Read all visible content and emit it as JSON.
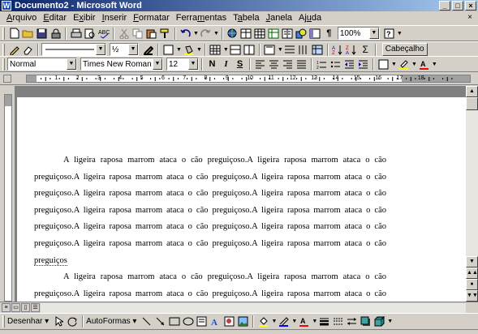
{
  "window": {
    "title": "Documento2 - Microsoft Word",
    "app_icon": "W"
  },
  "menu": [
    {
      "pre": "",
      "u": "A",
      "post": "rquivo"
    },
    {
      "pre": "",
      "u": "E",
      "post": "ditar"
    },
    {
      "pre": "E",
      "u": "x",
      "post": "ibir"
    },
    {
      "pre": "",
      "u": "I",
      "post": "nserir"
    },
    {
      "pre": "",
      "u": "F",
      "post": "ormatar"
    },
    {
      "pre": "Ferra",
      "u": "m",
      "post": "entas"
    },
    {
      "pre": "T",
      "u": "a",
      "post": "bela"
    },
    {
      "pre": "",
      "u": "J",
      "post": "anela"
    },
    {
      "pre": "Aj",
      "u": "u",
      "post": "da"
    }
  ],
  "toolbar": {
    "zoom": "100%",
    "line_width": "½",
    "style_button": "Cabeçalho"
  },
  "formatting": {
    "style": "Normal",
    "font": "Times New Roman",
    "size": "12",
    "bold": "N",
    "italic": "I",
    "underline": "S",
    "font_color_glyph": "A"
  },
  "ruler": {
    "numbers": [
      "1",
      "2",
      "3",
      "4",
      "5",
      "6",
      "7",
      "8",
      "9",
      "10",
      "11",
      "12",
      "13",
      "14",
      "15",
      "16",
      "17",
      "18"
    ]
  },
  "document": {
    "paragraph1": "A ligeira raposa marrom ataca o cão preguiçoso.A ligeira raposa marrom ataca o cão preguiçoso.A ligeira raposa marrom ataca o cão preguiçoso.A ligeira raposa marrom ataca o cão preguiçoso.A ligeira raposa marrom ataca o cão preguiçoso.A ligeira raposa marrom ataca o cão preguiçoso.A ligeira raposa marrom ataca o cão preguiçoso.A ligeira raposa marrom ataca o cão preguiçoso.A ligeira raposa marrom ataca o cão preguiçoso.A ligeira raposa marrom ataca o cão preguiçoso.A ligeira raposa marrom ataca o cão preguiçoso.A ligeira raposa marrom ataca o cão ",
    "misspelled": "preguiços",
    "paragraph2": "A ligeira raposa marrom ataca o cão preguiçoso.A ligeira raposa marrom ataca o cão preguiçoso.A ligeira raposa marrom ataca o cão preguiçoso.A ligeira raposa marrom ataca o cão preguiçoso.A ligeira raposa marrom ataca o cão preguiçoso."
  },
  "drawing": {
    "draw_label": "Desenhar",
    "autoshapes_label": "AutoFormas"
  },
  "colors": {
    "title_start": "#0a246a",
    "title_end": "#a6caf0",
    "highlight": "#ffff00",
    "font_color": "#ff0000"
  }
}
